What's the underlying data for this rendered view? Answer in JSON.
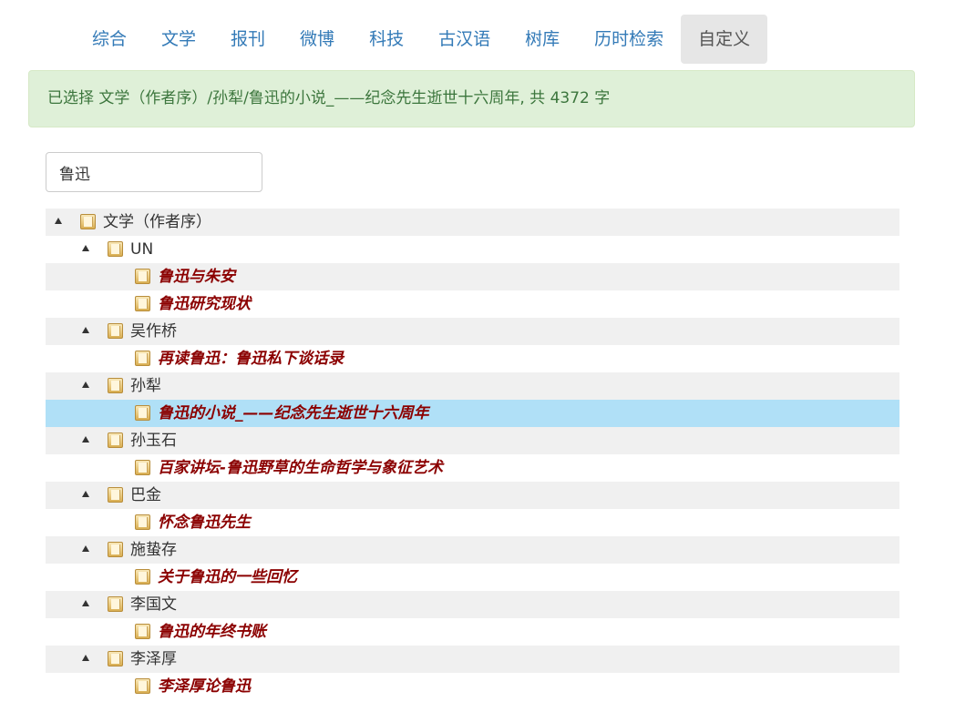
{
  "nav": {
    "tabs": [
      {
        "label": "综合"
      },
      {
        "label": "文学"
      },
      {
        "label": "报刊"
      },
      {
        "label": "微博"
      },
      {
        "label": "科技"
      },
      {
        "label": "古汉语"
      },
      {
        "label": "树库"
      },
      {
        "label": "历时检索"
      },
      {
        "label": "自定义"
      }
    ],
    "active": "自定义"
  },
  "alert": {
    "text": "已选择 文学（作者序）/孙犁/鲁迅的小说_——纪念先生逝世十六周年, 共 4372 字"
  },
  "search": {
    "value": "鲁迅"
  },
  "tree": {
    "rows": [
      {
        "label": "文学（作者序）",
        "level": 0,
        "expanded": true
      },
      {
        "label": "UN",
        "level": 1,
        "expanded": true
      },
      {
        "label": "鲁迅与朱安",
        "level": 2
      },
      {
        "label": "鲁迅研究现状",
        "level": 2
      },
      {
        "label": "吴作桥",
        "level": 1,
        "expanded": true
      },
      {
        "label": "再读鲁迅：鲁迅私下谈话录",
        "level": 2
      },
      {
        "label": "孙犁",
        "level": 1,
        "expanded": true
      },
      {
        "label": "鲁迅的小说_——纪念先生逝世十六周年",
        "level": 2,
        "selected": true
      },
      {
        "label": "孙玉石",
        "level": 1,
        "expanded": true
      },
      {
        "label": "百家讲坛-鲁迅野草的生命哲学与象征艺术",
        "level": 2
      },
      {
        "label": "巴金",
        "level": 1,
        "expanded": true
      },
      {
        "label": "怀念鲁迅先生",
        "level": 2
      },
      {
        "label": "施蛰存",
        "level": 1,
        "expanded": true
      },
      {
        "label": "关于鲁迅的一些回忆",
        "level": 2
      },
      {
        "label": "李国文",
        "level": 1,
        "expanded": true
      },
      {
        "label": "鲁迅的年终书账",
        "level": 2
      },
      {
        "label": "李泽厚",
        "level": 1,
        "expanded": true
      },
      {
        "label": "李泽厚论鲁迅",
        "level": 2
      }
    ]
  },
  "colors": {
    "nav_link": "#337ab7",
    "nav_active_bg": "#e6e6e6",
    "alert_bg": "#dff0d8",
    "alert_text": "#3c763d",
    "leaf_text": "#8b0000",
    "selected_row": "#b0e0f7",
    "stripe_row": "#f0f0f0"
  }
}
